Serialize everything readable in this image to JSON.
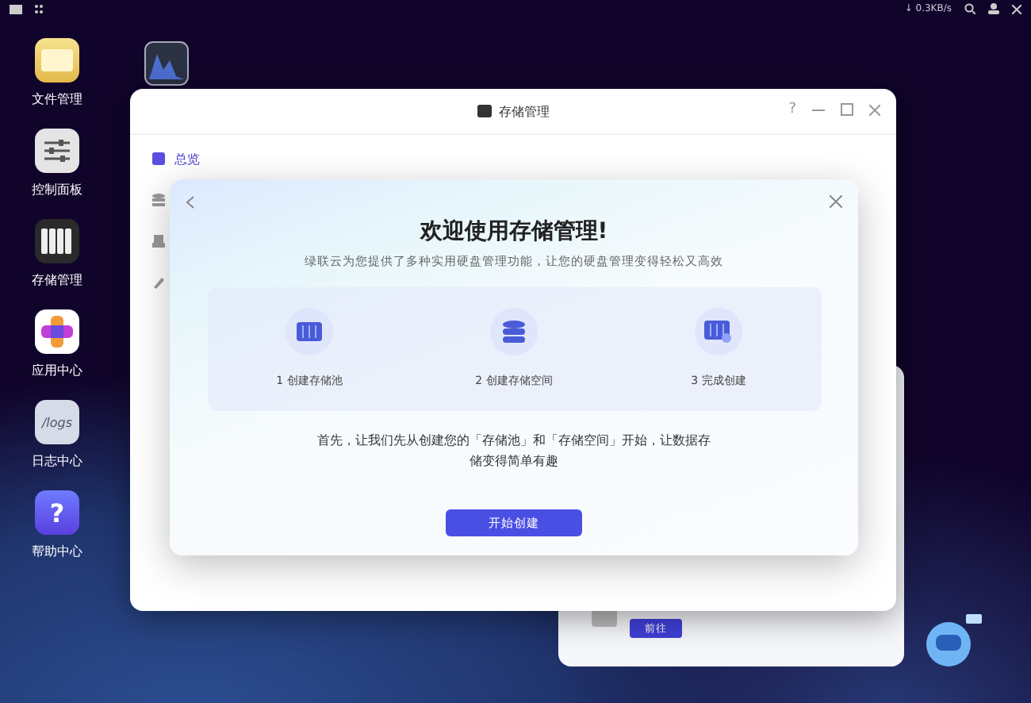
{
  "top_bar": {
    "network_speed": "↓ 0.3KB/s"
  },
  "desktop_icons": [
    {
      "label": "文件管理",
      "kind": "folder"
    },
    {
      "label": "控制面板",
      "kind": "sliders"
    },
    {
      "label": "存储管理",
      "kind": "drives"
    },
    {
      "label": "应用中心",
      "kind": "apps"
    },
    {
      "label": "日志中心",
      "kind": "logs",
      "icon_text": "/logs"
    },
    {
      "label": "帮助中心",
      "kind": "help",
      "icon_text": "?"
    }
  ],
  "window": {
    "title": "存储管理",
    "help": "?",
    "sidebar": [
      {
        "label": "总览",
        "kind": "overview",
        "selected": true
      },
      {
        "kind": "database",
        "selected": false
      },
      {
        "kind": "drive",
        "selected": false
      },
      {
        "kind": "tools",
        "selected": false
      }
    ]
  },
  "dialog": {
    "title": "欢迎使用存储管理!",
    "subtitle": "绿联云为您提供了多种实用硬盘管理功能，让您的硬盘管理变得轻松又高效",
    "steps": [
      {
        "label": "1 创建存储池",
        "kind": "pool"
      },
      {
        "label": "2 创建存储空间",
        "kind": "database"
      },
      {
        "label": "3 完成创建",
        "kind": "done"
      }
    ],
    "text": "首先，让我们先从创建您的「存储池」和「存储空间」开始，让数据存储变得简单有趣",
    "button": "开始创建"
  },
  "back_window": {
    "button": "前往"
  }
}
